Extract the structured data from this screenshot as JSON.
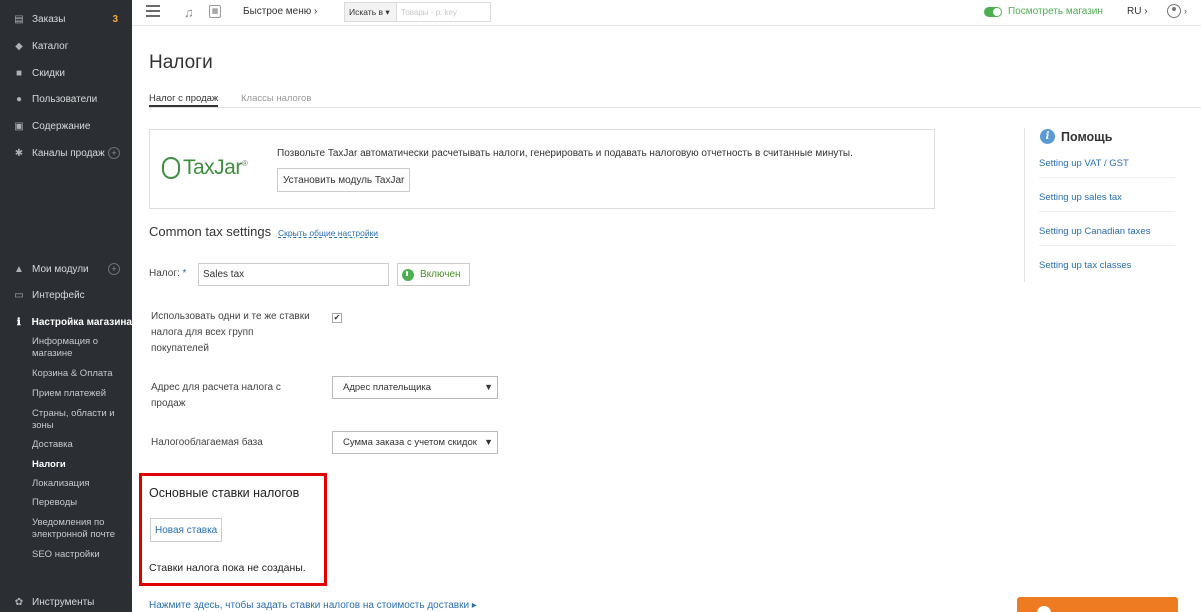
{
  "sidebar": {
    "top_items": [
      {
        "label": "Заказы",
        "badge": "3",
        "icon": "orders-icon"
      },
      {
        "label": "Каталог",
        "icon": "tag-icon"
      },
      {
        "label": "Скидки",
        "icon": "gift-icon"
      },
      {
        "label": "Пользователи",
        "icon": "users-icon"
      },
      {
        "label": "Содержание",
        "icon": "content-icon"
      },
      {
        "label": "Каналы продаж",
        "icon": "channels-icon"
      }
    ],
    "bottom_items": [
      {
        "label": "Мои модули",
        "icon": "modules-icon"
      },
      {
        "label": "Интерфейс",
        "icon": "interface-icon"
      },
      {
        "label": "Настройка магазина",
        "icon": "info-icon"
      }
    ],
    "sub_items": [
      "Информация о магазине",
      "Корзина & Оплата",
      "Прием платежей",
      "Страны, области и зоны",
      "Доставка",
      "Налоги",
      "Локализация",
      "Переводы",
      "Уведомления по электронной почте",
      "SEO настройки"
    ],
    "tools": {
      "label": "Инструменты",
      "icon": "tools-icon"
    }
  },
  "topbar": {
    "quick_menu": "Быстрое меню",
    "search_scope": "Искать в",
    "search_placeholder": "Товары - p. key",
    "view_store": "Посмотреть магазин",
    "language": "RU"
  },
  "page": {
    "title": "Налоги",
    "tabs": [
      "Налог с продаж",
      "Классы налогов"
    ]
  },
  "taxjar": {
    "logo_text": "TaxJar",
    "description": "Позвольте TaxJar автоматически расчетывать налоги, генерировать и подавать налоговую отчетность в считанные минуты.",
    "install_button": "Установить модуль TaxJar"
  },
  "common": {
    "title": "Common tax settings",
    "hide_link": "Скрыть общие настройки",
    "tax_label": "Налог:",
    "tax_value": "Sales tax",
    "enabled_label": "Включен",
    "same_rates_label": "Использовать одни и те же ставки налога для всех групп покупателей",
    "same_rates_checked": true,
    "address_label": "Адрес для расчета налога с продаж",
    "address_value": "Адрес плательщика",
    "base_label": "Налогооблагаемая база",
    "base_value": "Сумма заказа с учетом скидок"
  },
  "rates": {
    "title": "Основные ставки налогов",
    "new_rate_button": "Новая ставка",
    "empty_text": "Ставки налога пока не созданы.",
    "shipping_link": "Нажмите здесь, чтобы задать ставки налогов на стоимость доставки"
  },
  "help": {
    "title": "Помощь",
    "links": [
      "Setting up VAT / GST",
      "Setting up sales tax",
      "Setting up Canadian taxes",
      "Setting up tax classes"
    ]
  },
  "colors": {
    "sidebar_bg": "#2b2f33",
    "accent_green": "#4caf50",
    "link_blue": "#2a6fb5",
    "highlight_red": "#e00000",
    "orange": "#ee7a22"
  }
}
